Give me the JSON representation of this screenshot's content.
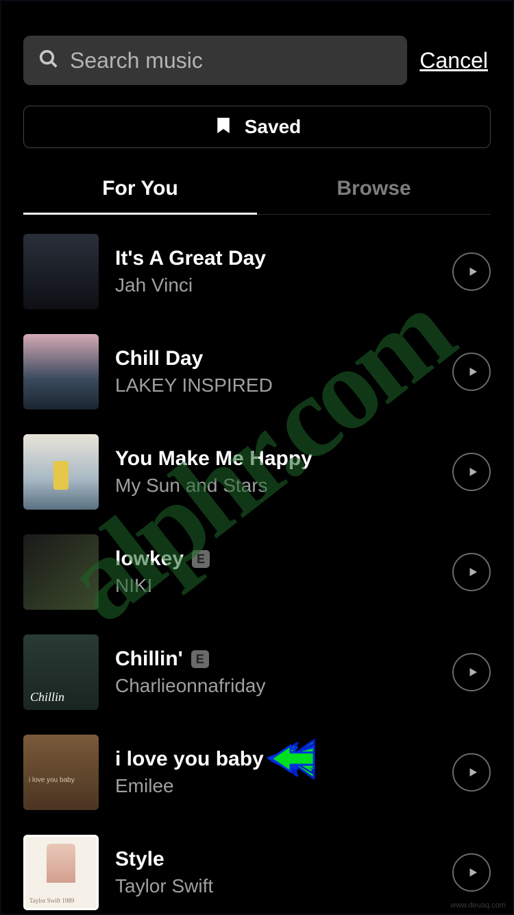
{
  "search": {
    "placeholder": "Search music"
  },
  "cancel_label": "Cancel",
  "saved_label": "Saved",
  "tabs": {
    "for_you": "For You",
    "browse": "Browse"
  },
  "explicit_badge_letter": "E",
  "tracks": [
    {
      "title": "It's A Great Day",
      "artist": "Jah Vinci",
      "explicit": false
    },
    {
      "title": "Chill Day",
      "artist": "LAKEY INSPIRED",
      "explicit": false
    },
    {
      "title": "You Make Me Happy",
      "artist": "My Sun and Stars",
      "explicit": false
    },
    {
      "title": "lowkey",
      "artist": "NIKI",
      "explicit": true
    },
    {
      "title": "Chillin'",
      "artist": "Charlieonnafriday",
      "explicit": true
    },
    {
      "title": "i love you baby",
      "artist": "Emilee",
      "explicit": false
    },
    {
      "title": "Style",
      "artist": "Taylor Swift",
      "explicit": false
    }
  ],
  "watermark_text": "alphr.com",
  "attribution_text": "www.deuaq.com"
}
